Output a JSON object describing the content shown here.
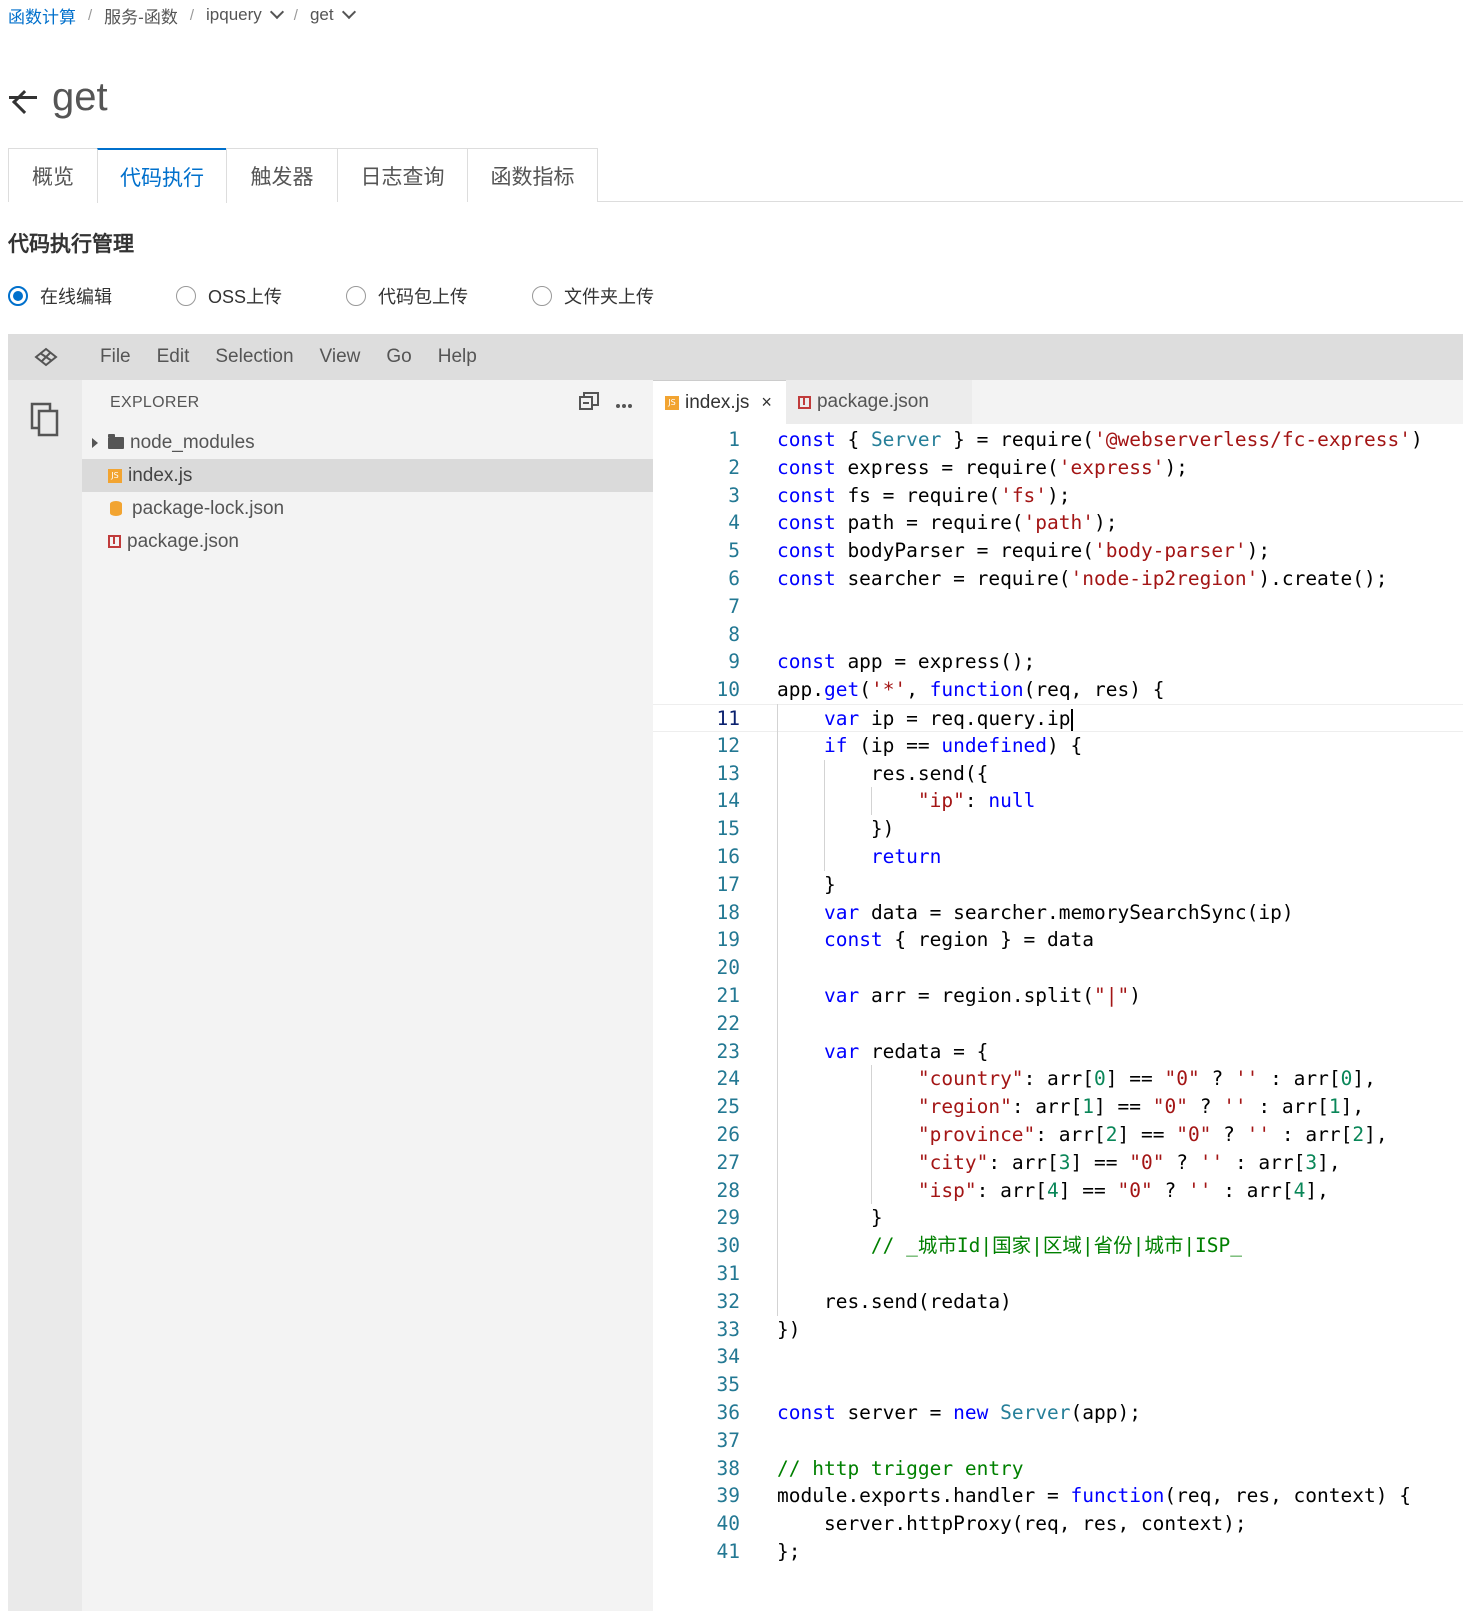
{
  "breadcrumb": {
    "items": [
      "函数计算",
      "服务-函数",
      "ipquery",
      "get"
    ],
    "separator": "/"
  },
  "page": {
    "title": "get"
  },
  "tabs": [
    "概览",
    "代码执行",
    "触发器",
    "日志查询",
    "函数指标"
  ],
  "active_tab": "代码执行",
  "section_title": "代码执行管理",
  "upload_options": [
    {
      "label": "在线编辑",
      "checked": true
    },
    {
      "label": "OSS上传",
      "checked": false
    },
    {
      "label": "代码包上传",
      "checked": false
    },
    {
      "label": "文件夹上传",
      "checked": false
    }
  ],
  "ide": {
    "menu": [
      "File",
      "Edit",
      "Selection",
      "View",
      "Go",
      "Help"
    ],
    "explorer_title": "EXPLORER",
    "files": [
      {
        "name": "node_modules",
        "type": "folder"
      },
      {
        "name": "index.js",
        "type": "js",
        "selected": true
      },
      {
        "name": "package-lock.json",
        "type": "lock"
      },
      {
        "name": "package.json",
        "type": "npm"
      }
    ],
    "editor_tabs": [
      {
        "name": "index.js",
        "active": true,
        "close": "×"
      },
      {
        "name": "package.json",
        "active": false
      }
    ],
    "current_line": 11,
    "code_lines": [
      "const { Server } = require('@webserverless/fc-express')",
      "const express = require('express');",
      "const fs = require('fs');",
      "const path = require('path');",
      "const bodyParser = require('body-parser');",
      "const searcher = require('node-ip2region').create();",
      "",
      "",
      "const app = express();",
      "app.get('*', function(req, res) {",
      "    var ip = req.query.ip",
      "    if (ip == undefined) {",
      "        res.send({",
      "            \"ip\": null",
      "        })",
      "        return",
      "    }",
      "    var data = searcher.memorySearchSync(ip)",
      "    const { region } = data",
      "",
      "    var arr = region.split(\"|\")",
      "",
      "    var redata = {",
      "            \"country\": arr[0] == \"0\" ? '' : arr[0],",
      "            \"region\": arr[1] == \"0\" ? '' : arr[1],",
      "            \"province\": arr[2] == \"0\" ? '' : arr[2],",
      "            \"city\": arr[3] == \"0\" ? '' : arr[3],",
      "            \"isp\": arr[4] == \"0\" ? '' : arr[4],",
      "        }",
      "        // _城市Id|国家|区域|省份|城市|ISP_",
      "",
      "    res.send(redata)",
      "})",
      "",
      "",
      "const server = new Server(app);",
      "",
      "// http trigger entry",
      "module.exports.handler = function(req, res, context) {",
      "    server.httpProxy(req, res, context);",
      "};"
    ]
  },
  "colors": {
    "link_blue": "#0070cc",
    "keyword": "#0000ff",
    "string": "#a31515",
    "type": "#267f99",
    "comment": "#008000",
    "number": "#098658",
    "line_number": "#237893"
  }
}
